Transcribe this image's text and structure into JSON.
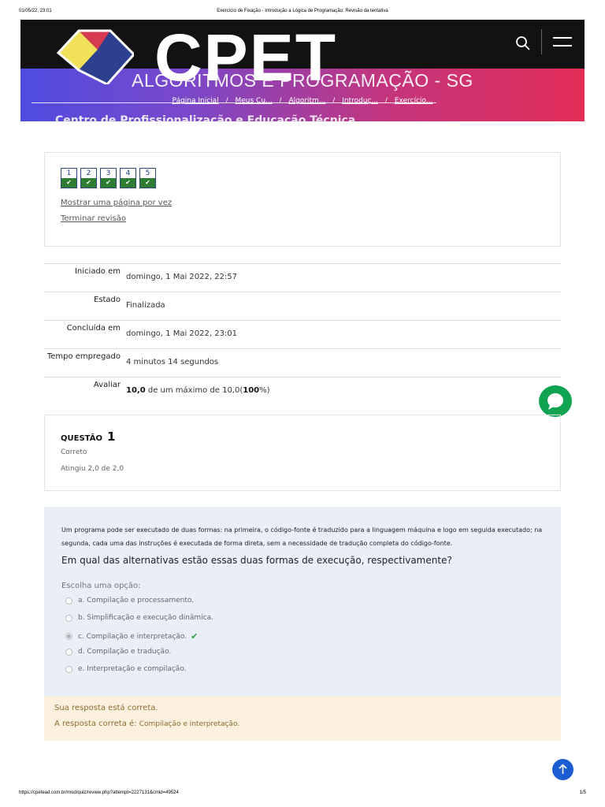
{
  "print_header": {
    "datetime": "01/05/22, 23:01",
    "page_title": "Exercício de Fixação - Introdução a Lógica de Programação: Revisão da tentativa"
  },
  "print_footer": {
    "url": "https://cpetead.com.br/mod/quiz/review.php?attempt=2227131&cmid=49524",
    "page": "1/5"
  },
  "header": {
    "brand": "CPET",
    "course_title": "ALGORITMOS E PROGRAMAÇÃO - SG",
    "subtitle": "Centro de Profissionalização e Educação Técnica",
    "breadcrumb": [
      "Página Inicial",
      "Meus Cu...",
      "Algoritm...",
      "Introduç...",
      "Exercício..."
    ],
    "breadcrumb_sep": "/",
    "logo_colors": [
      "#f0e05a",
      "#d63b52",
      "#2d3f8f"
    ]
  },
  "quiz_nav": {
    "questions": [
      {
        "label": "1",
        "status": "✔"
      },
      {
        "label": "2",
        "status": "✔"
      },
      {
        "label": "3",
        "status": "✔"
      },
      {
        "label": "4",
        "status": "✔"
      },
      {
        "label": "5",
        "status": "✔"
      }
    ],
    "show_one_page": "Mostrar uma página por vez",
    "finish_review": "Terminar revisão"
  },
  "summary": {
    "started_label": "Iniciado em",
    "started_value": "domingo, 1 Mai 2022, 22:57",
    "state_label": "Estado",
    "state_value": "Finalizada",
    "completed_label": "Concluída em",
    "completed_value": "domingo, 1 Mai 2022, 23:01",
    "time_label": "Tempo empregado",
    "time_value": "4 minutos 14 segundos",
    "grade_label": "Avaliar",
    "grade_score": "10,0",
    "grade_middle": " de um máximo de 10,0(",
    "grade_percent": "100",
    "grade_end": "%)"
  },
  "question": {
    "label": "QUESTÃO",
    "number": "1",
    "state": "Correto",
    "mark": "Atingiu 2,0 de 2,0",
    "intro": "Um programa pode ser executado de duas formas: na primeira, o código-fonte é traduzido para a linguagem máquina e logo em seguida executado; na segunda, cada uma das instruções é executada de forma direta, sem a necessidade de tradução completa do código-fonte.",
    "prompt": "Em qual das alternativas estão essas duas formas de execução, respectivamente?",
    "choose_label": "Escolha uma opção:",
    "options": [
      {
        "text": "a. Compilação e processamento.",
        "selected": false
      },
      {
        "text": "b. Simplificação e execução dinâmica.",
        "selected": false
      },
      {
        "text": "c. Compilação e interpretação.",
        "selected": true
      },
      {
        "text": "d. Compilação e tradução.",
        "selected": false
      },
      {
        "text": "e. Interpretação e compilação.",
        "selected": false
      }
    ],
    "correct_icon": "✔"
  },
  "feedback": {
    "result": "Sua resposta está correta.",
    "correct_label": "A resposta correta é: ",
    "correct_answer": "Compilação e interpretação."
  },
  "icons": {
    "search": "search-icon",
    "menu": "hamburger-menu-icon",
    "chat": "chat-bubble-icon",
    "back_to_top": "arrow-up-icon"
  },
  "colors": {
    "correct_green": "#2e7d32",
    "chat_green": "#10a352",
    "top_button_blue": "#1c5dd4",
    "feedback_bg": "#fcf1df",
    "question_bg": "#e9eef7"
  }
}
